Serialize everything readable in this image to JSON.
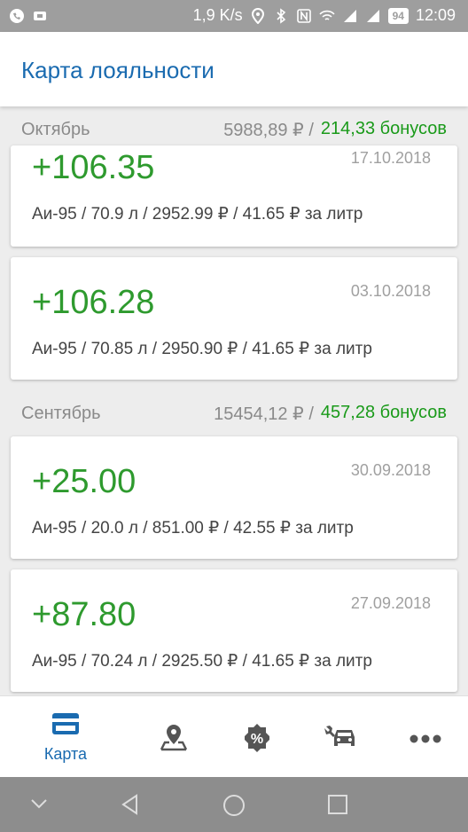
{
  "status_bar": {
    "speed": "1,9 K/s",
    "battery": "94",
    "time": "12:09"
  },
  "appbar": {
    "title": "Карта лояльности"
  },
  "months": [
    {
      "name": "Октябрь",
      "sum": "5988,89 ₽ /",
      "bonus": "214,33 бонусов",
      "transactions": [
        {
          "amount": "+106.35",
          "date": "17.10.2018",
          "detail": "Аи-95 / 70.9 л / 2952.99 ₽ / 41.65 ₽ за литр"
        },
        {
          "amount": "+106.28",
          "date": "03.10.2018",
          "detail": "Аи-95 / 70.85 л / 2950.90 ₽ / 41.65 ₽ за литр"
        }
      ]
    },
    {
      "name": "Сентябрь",
      "sum": "15454,12 ₽ /",
      "bonus": "457,28 бонусов",
      "transactions": [
        {
          "amount": "+25.00",
          "date": "30.09.2018",
          "detail": "Аи-95 / 20.0 л / 851.00 ₽ / 42.55 ₽ за литр"
        },
        {
          "amount": "+87.80",
          "date": "27.09.2018",
          "detail": "Аи-95 / 70.24 л / 2925.50 ₽ / 41.65 ₽ за литр"
        }
      ]
    }
  ],
  "bottom_nav": {
    "card_label": "Карта",
    "icons": [
      "card-icon",
      "map-pin-icon",
      "discount-icon",
      "car-service-icon",
      "more-icon"
    ]
  },
  "colors": {
    "accent": "#1a6bb0",
    "positive": "#2e9a2e",
    "bonus": "#1a9a1a"
  }
}
